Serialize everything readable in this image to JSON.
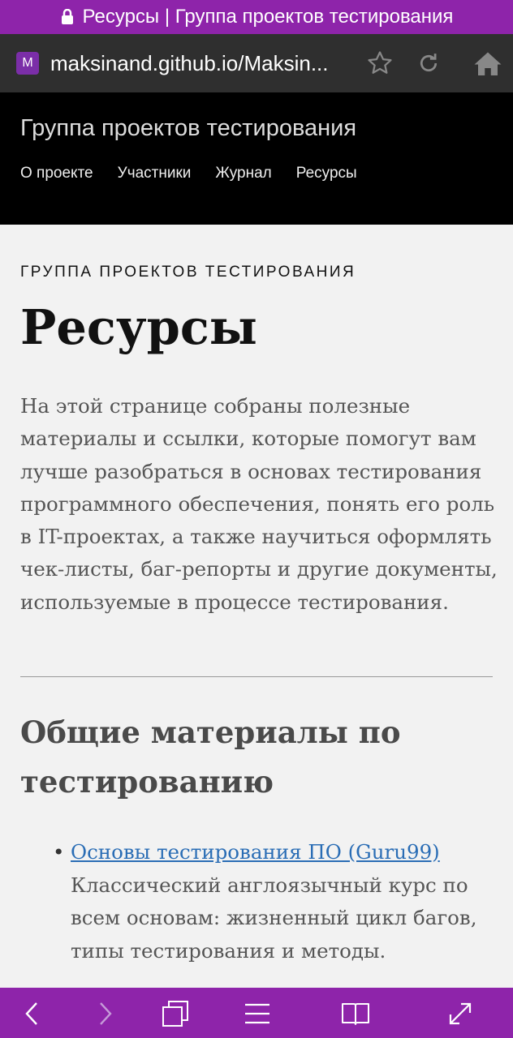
{
  "status_bar": {
    "tab_title": "Ресурсы | Группа проектов тестирования"
  },
  "address_bar": {
    "favicon_letter": "M",
    "url": "maksinand.github.io/Maksin..."
  },
  "site_header": {
    "title": "Группа проектов тестирования",
    "nav": [
      "О проекте",
      "Участники",
      "Журнал",
      "Ресурсы"
    ]
  },
  "page": {
    "kicker": "ГРУППА ПРОЕКТОВ ТЕСТИРОВАНИЯ",
    "title": "Ресурсы",
    "intro": "На этой странице собраны полезные материалы и ссылки, которые помогут вам лучше разобраться в основах тестирования программного обеспечения, понять его роль в IT-проектах, а также научиться оформлять чек-листы, баг-репорты и другие документы, используемые в процессе тестирования.",
    "section_title": "Общие материалы по тестированию",
    "resources": [
      {
        "link": "Основы тестирования ПО (Guru99)",
        "description": "Классический англоязычный курс по всем основам: жизненный цикл багов, типы тестирования и методы."
      }
    ]
  },
  "colors": {
    "status_bar": "#8e24aa",
    "link": "#2a6db5",
    "header_bg": "#000000"
  }
}
